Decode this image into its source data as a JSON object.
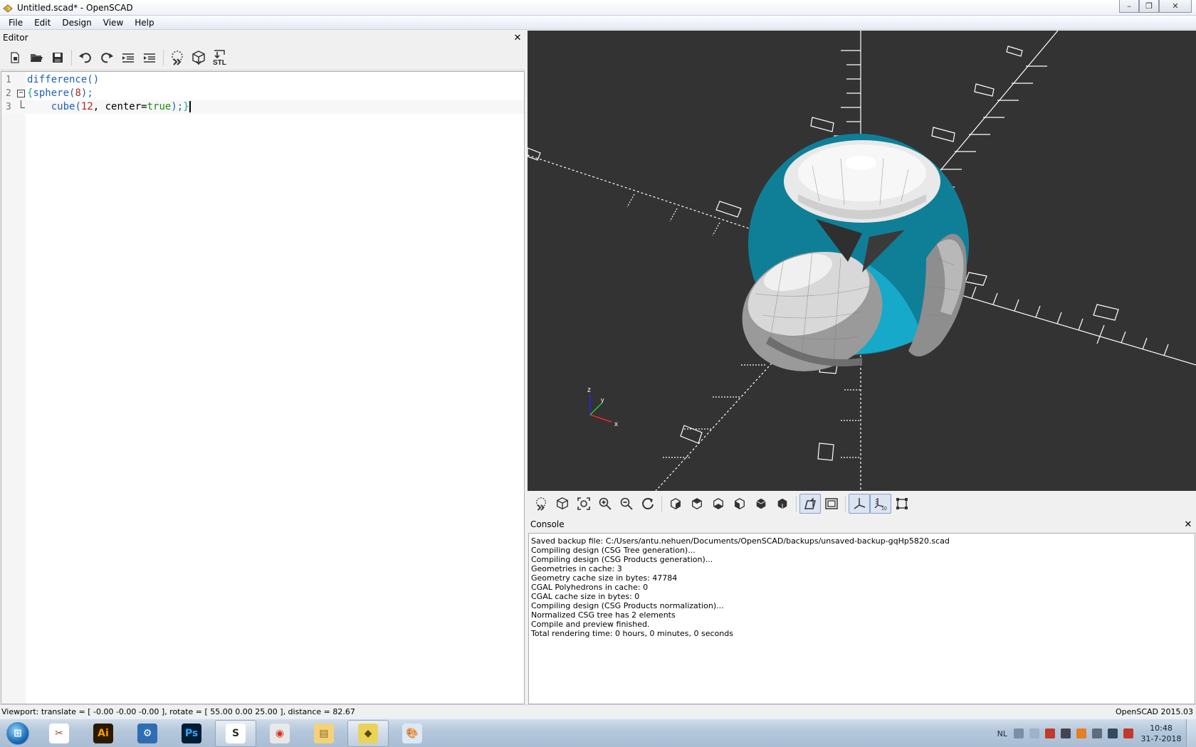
{
  "window": {
    "title": "Untitled.scad* - OpenSCAD",
    "minimize": "–",
    "maximize": "❐",
    "close": "✕"
  },
  "menu": [
    "File",
    "Edit",
    "Design",
    "View",
    "Help"
  ],
  "editor": {
    "title": "Editor",
    "close": "✕",
    "toolbar": [
      "new-icon",
      "open-icon",
      "save-icon",
      "undo-icon",
      "redo-icon",
      "unindent-icon",
      "indent-icon",
      "preview-icon",
      "render-icon",
      "export-stl-icon"
    ],
    "stl_label": "STL",
    "lines": [
      {
        "num": "1",
        "text": "difference()"
      },
      {
        "num": "2",
        "text": "{sphere(8);"
      },
      {
        "num": "3",
        "text": "    cube(12, center=true);}"
      }
    ],
    "tokens": {
      "l1_fn": "difference",
      "l1_paren": "()",
      "l2_brace": "{",
      "l2_fn": "sphere",
      "l2_open": "(",
      "l2_num": "8",
      "l2_close": ");",
      "l3_indent": "    ",
      "l3_fn": "cube",
      "l3_open": "(",
      "l3_num": "12",
      "l3_comma": ", ",
      "l3_kw": "center",
      "l3_eq": "=",
      "l3_val": "true",
      "l3_close": ");",
      "l3_brace": "}"
    }
  },
  "view": {
    "axis_labels": {
      "z": "z",
      "y": "y",
      "x": "x"
    },
    "toolbar": [
      "preview-icon",
      "render-icon",
      "view-all-icon",
      "zoom-in-icon",
      "zoom-out-icon",
      "reset-view-icon",
      "view-right-icon",
      "view-top-icon",
      "view-bottom-icon",
      "view-left-icon",
      "view-front-icon",
      "view-back-icon",
      "perspective-icon",
      "orthogonal-icon",
      "show-axes-icon",
      "show-scale-markers-icon",
      "show-edges-icon"
    ],
    "colors": {
      "background": "#333333",
      "cut_face": "#0f7f98",
      "cut_face_light": "#17a9c9",
      "axis": "#ffffff"
    }
  },
  "console": {
    "title": "Console",
    "close": "✕",
    "lines": [
      "Saved backup file: C:/Users/antu.nehuen/Documents/OpenSCAD/backups/unsaved-backup-gqHp5820.scad",
      "Compiling design (CSG Tree generation)...",
      "Compiling design (CSG Products generation)...",
      "Geometries in cache: 3",
      "Geometry cache size in bytes: 47784",
      "CGAL Polyhedrons in cache: 0",
      "CGAL cache size in bytes: 0",
      "Compiling design (CSG Products normalization)...",
      "Normalized CSG tree has 2 elements",
      "Compile and preview finished.",
      "Total rendering time: 0 hours, 0 minutes, 0 seconds"
    ]
  },
  "status": {
    "viewport": "Viewport: translate = [ -0.00 -0.00 -0.00 ], rotate = [ 55.00 0.00 25.00 ], distance = 82.67",
    "version": "OpenSCAD 2015.03"
  },
  "taskbar": {
    "start": "⊞",
    "apps": [
      {
        "name": "snipping-tool-icon",
        "label": "✂",
        "color": "#ffffff",
        "fg": "#c0392b"
      },
      {
        "name": "illustrator-icon",
        "label": "Ai",
        "color": "#2b1a00",
        "fg": "#ff9a00"
      },
      {
        "name": "control-panel-icon",
        "label": "⚙",
        "color": "#2f6db3",
        "fg": "#ffffff"
      },
      {
        "name": "photoshop-icon",
        "label": "Ps",
        "color": "#001d34",
        "fg": "#31a8ff"
      },
      {
        "name": "sketch-icon",
        "label": "S",
        "color": "#ffffff",
        "fg": "#2c2c2c"
      },
      {
        "name": "chrome-icon",
        "label": "◉",
        "color": "#e8e8e8",
        "fg": "#d93025"
      },
      {
        "name": "explorer-icon",
        "label": "▤",
        "color": "#f3d27a",
        "fg": "#8a6a1d"
      },
      {
        "name": "openscad-icon",
        "label": "◆",
        "color": "#e9d35a",
        "fg": "#5a4d0f"
      },
      {
        "name": "paint-icon",
        "label": "🎨",
        "color": "#dbe8f5",
        "fg": "#335"
      }
    ],
    "lang": "NL",
    "time": "10:48",
    "date": "31-7-2018"
  }
}
